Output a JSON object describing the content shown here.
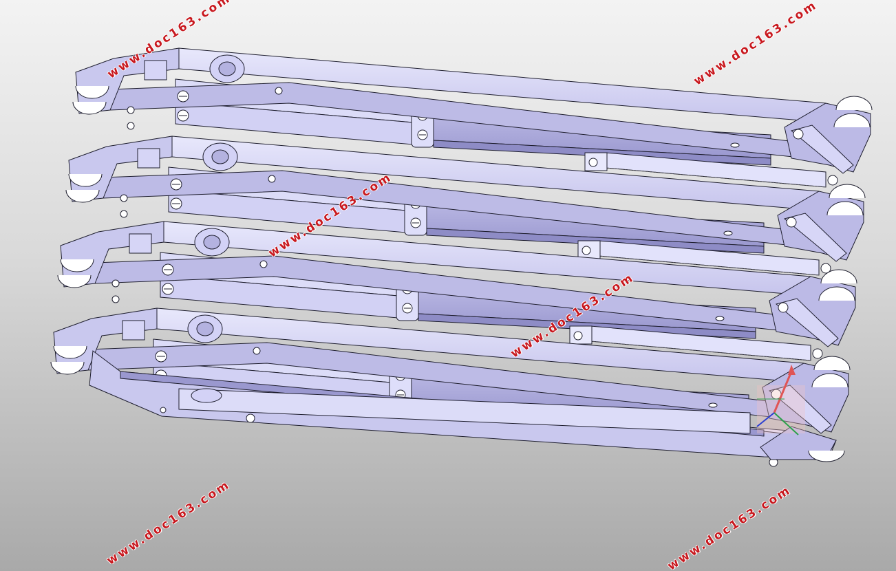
{
  "watermark_text": "www.doc163.com",
  "watermarks": [
    "www.doc163.com",
    "www.doc163.com",
    "www.doc163.com",
    "www.doc163.com",
    "www.doc163.com",
    "www.doc163.com",
    "www.doc163.com"
  ],
  "colors": {
    "background_top": "#f3f3f3",
    "background_bottom": "#a9a9a9",
    "part_fill": "#c9c8ee",
    "part_shade": "#a9a7db",
    "part_light": "#e6e6fb",
    "edge": "#1e1e2e",
    "watermark": "#c8181e"
  },
  "icons": [
    "triad-axis-icon"
  ]
}
